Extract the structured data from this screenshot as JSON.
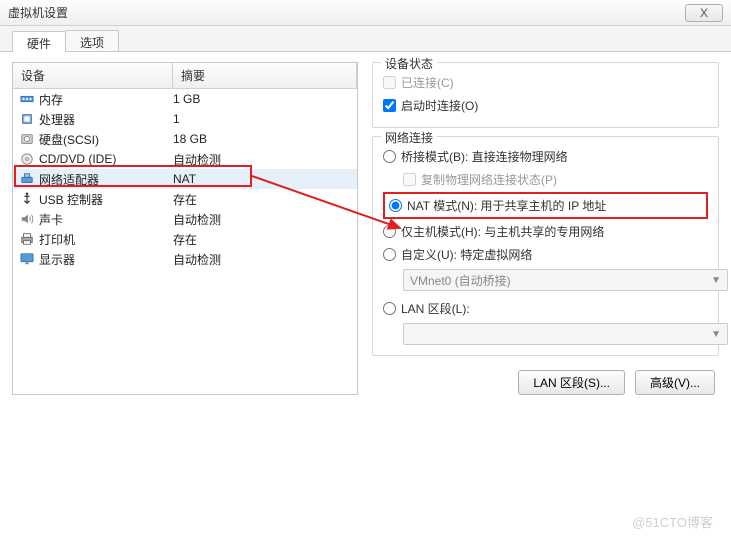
{
  "window": {
    "title": "虚拟机设置",
    "close": "X"
  },
  "tabs": {
    "hardware": "硬件",
    "options": "选项"
  },
  "list": {
    "col_device": "设备",
    "col_summary": "摘要",
    "rows": [
      {
        "name": "内存",
        "summary": "1 GB",
        "icon": "memory"
      },
      {
        "name": "处理器",
        "summary": "1",
        "icon": "cpu"
      },
      {
        "name": "硬盘(SCSI)",
        "summary": "18 GB",
        "icon": "disk"
      },
      {
        "name": "CD/DVD (IDE)",
        "summary": "自动检测",
        "icon": "cd"
      },
      {
        "name": "网络适配器",
        "summary": "NAT",
        "icon": "net"
      },
      {
        "name": "USB 控制器",
        "summary": "存在",
        "icon": "usb"
      },
      {
        "name": "声卡",
        "summary": "自动检测",
        "icon": "sound"
      },
      {
        "name": "打印机",
        "summary": "存在",
        "icon": "printer"
      },
      {
        "name": "显示器",
        "summary": "自动检测",
        "icon": "display"
      }
    ]
  },
  "status": {
    "group": "设备状态",
    "connected": "已连接(C)",
    "connect_on_start": "启动时连接(O)"
  },
  "network": {
    "group": "网络连接",
    "bridged": "桥接模式(B): 直接连接物理网络",
    "replicate": "复制物理网络连接状态(P)",
    "nat": "NAT 模式(N): 用于共享主机的 IP 地址",
    "hostonly": "仅主机模式(H): 与主机共享的专用网络",
    "custom": "自定义(U): 特定虚拟网络",
    "custom_value": "VMnet0 (自动桥接)",
    "lan": "LAN 区段(L):",
    "lan_value": ""
  },
  "buttons": {
    "lan_seg": "LAN 区段(S)...",
    "advanced": "高级(V)..."
  },
  "watermark": "@51CTO博客"
}
